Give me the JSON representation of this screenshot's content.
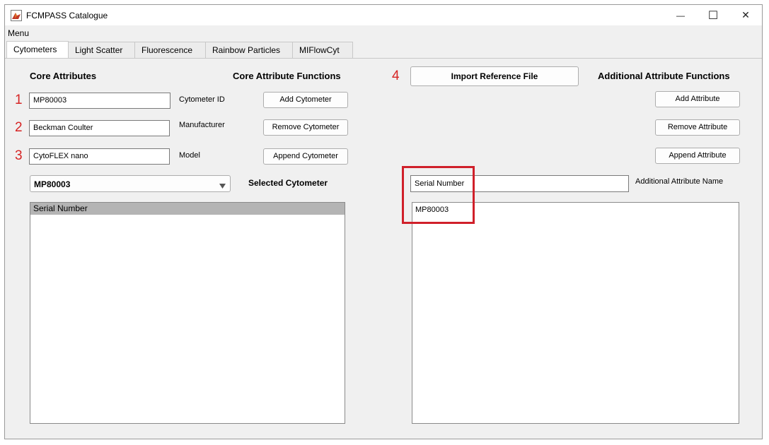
{
  "window": {
    "title": "FCMPASS Catalogue",
    "controls": {
      "minimize": "—",
      "maximize": "☐",
      "close": "✕"
    }
  },
  "menu": {
    "label": "Menu"
  },
  "tabs": [
    {
      "label": "Cytometers",
      "active": true
    },
    {
      "label": "Light Scatter"
    },
    {
      "label": "Fluorescence"
    },
    {
      "label": "Rainbow Particles"
    },
    {
      "label": "MIFlowCyt"
    }
  ],
  "core": {
    "heading": "Core Attributes",
    "functions_heading": "Core Attribute Functions",
    "fields": [
      {
        "number": "1",
        "value": "MP80003",
        "label": "Cytometer ID"
      },
      {
        "number": "2",
        "value": "Beckman Coulter",
        "label": "Manufacturer"
      },
      {
        "number": "3",
        "value": "CytoFLEX nano",
        "label": "Model"
      }
    ],
    "buttons": {
      "add": "Add Cytometer",
      "remove": "Remove Cytometer",
      "append": "Append Cytometer"
    },
    "dropdown_value": "MP80003",
    "selected_label": "Selected Cytometer",
    "list_items": [
      "Serial Number"
    ]
  },
  "import": {
    "number": "4",
    "label": "Import Reference File"
  },
  "additional": {
    "heading": "Additional Attribute Functions",
    "buttons": {
      "add": "Add Attribute",
      "remove": "Remove Attribute",
      "append": "Append Attribute"
    },
    "name_value": "Serial Number",
    "name_label": "Additional Attribute Name",
    "text_value": "MP80003"
  },
  "colors": {
    "annotation_red": "#d62424",
    "highlight_box": "#d0202a",
    "list_selected": "#b4b4b4"
  }
}
